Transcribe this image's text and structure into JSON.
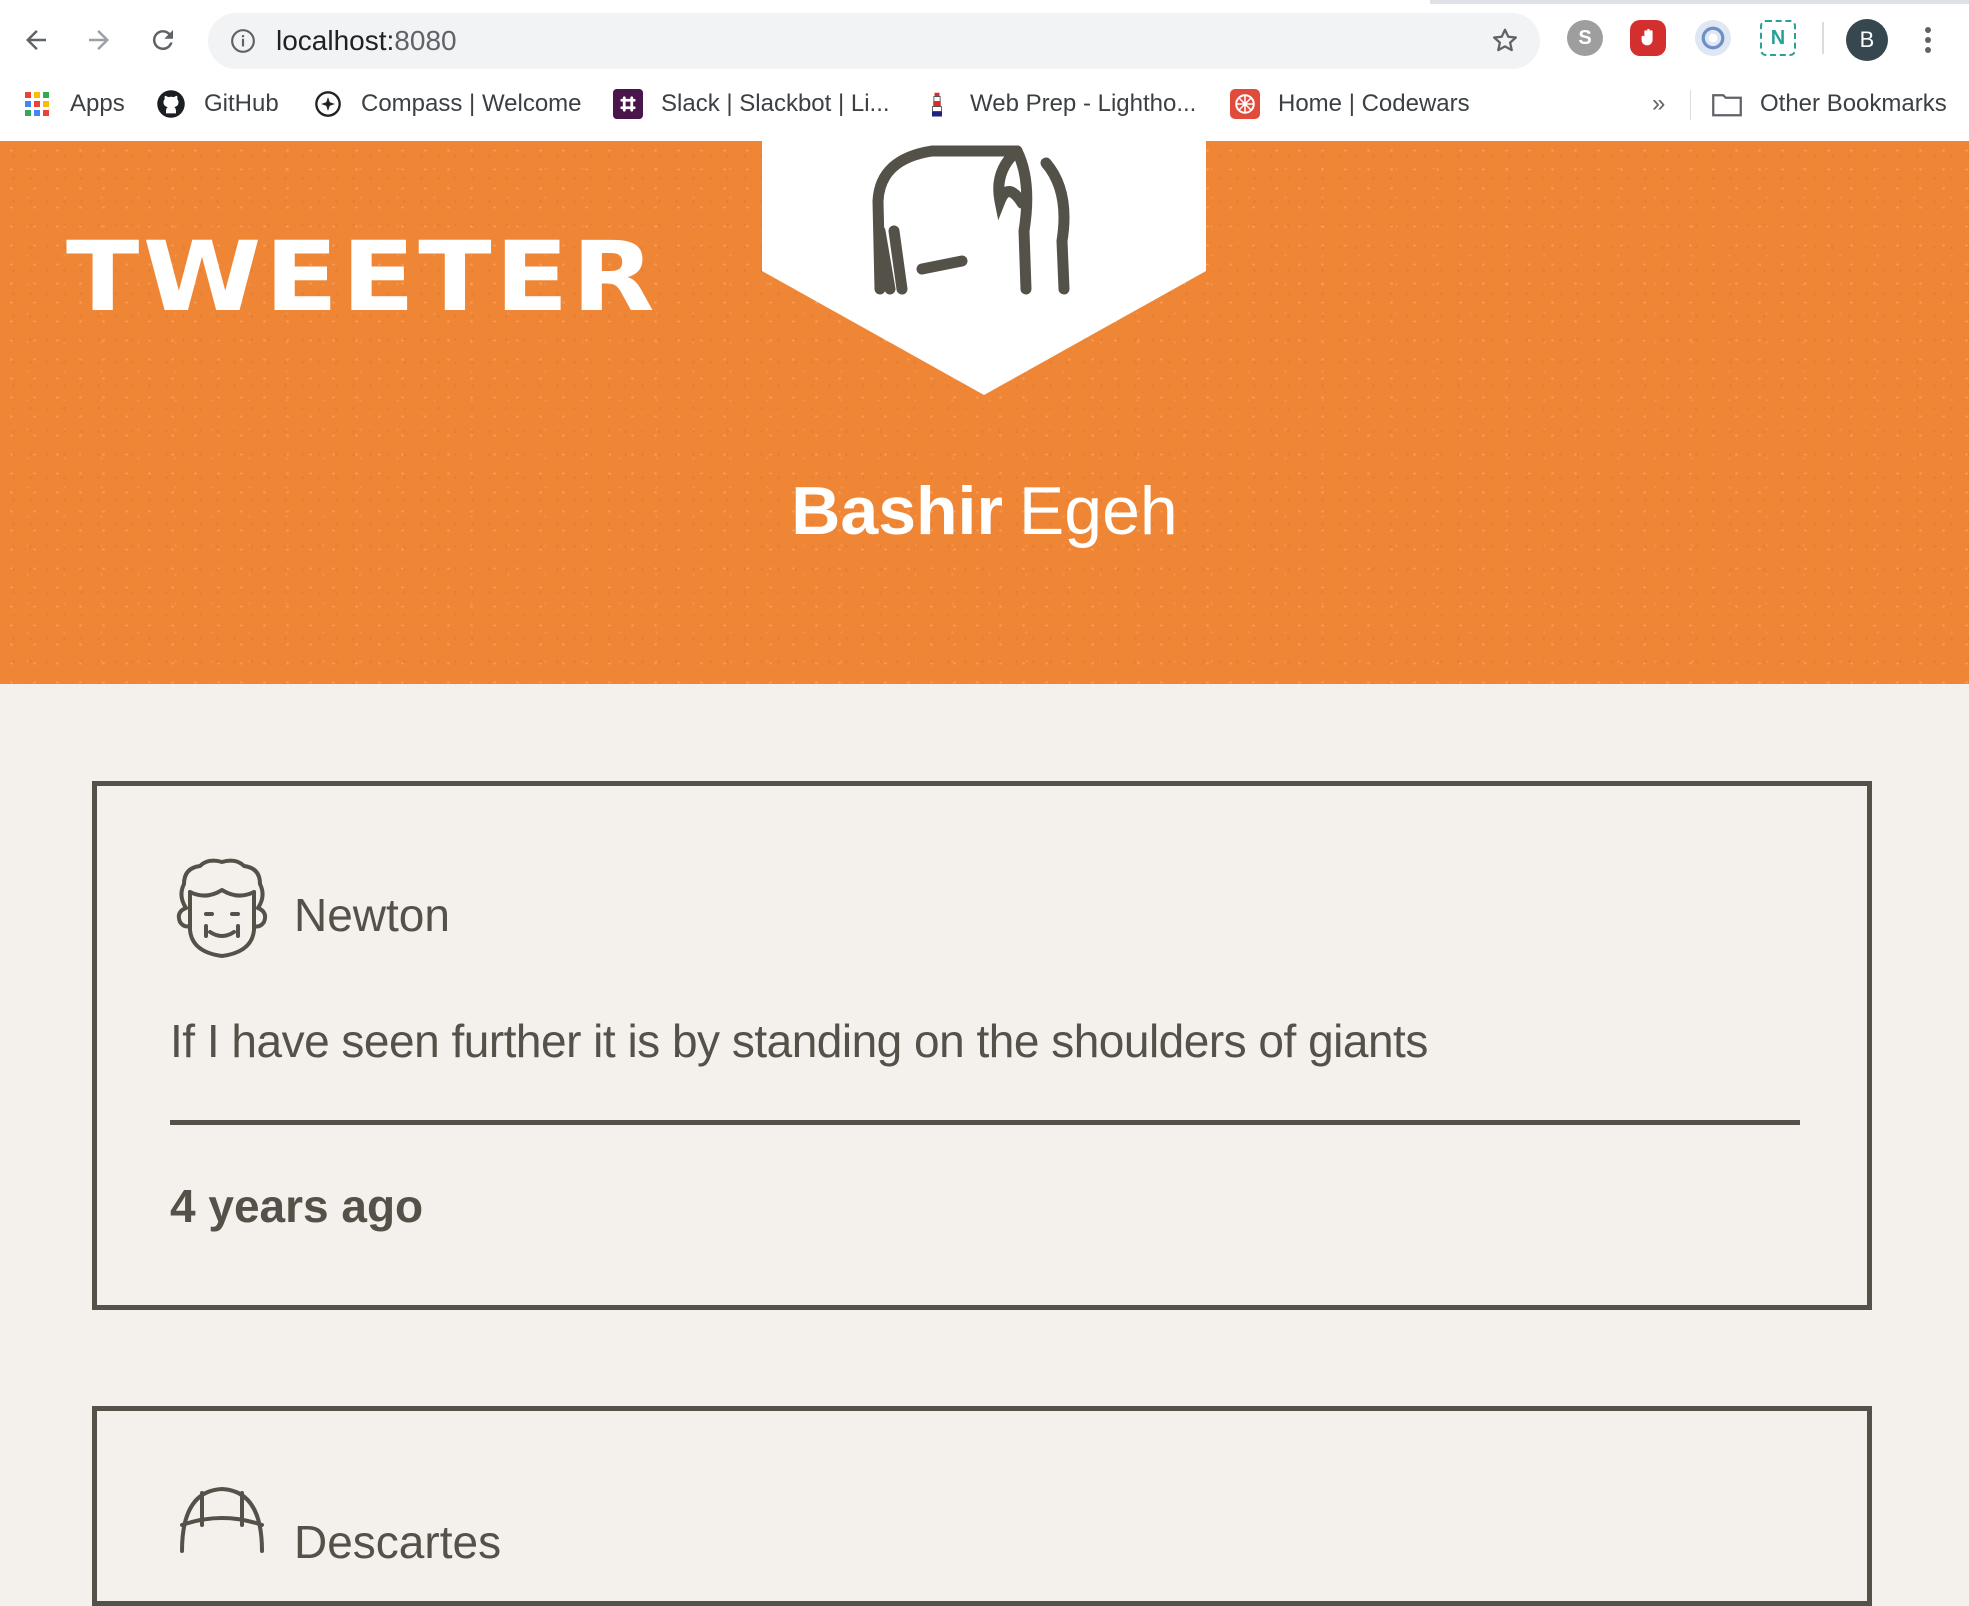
{
  "browser": {
    "url_host": "localhost:",
    "url_port": "8080",
    "profile_initial": "B",
    "bookmarks": [
      {
        "label": "Apps",
        "icon": "apps-grid-icon"
      },
      {
        "label": "GitHub",
        "icon": "github-icon"
      },
      {
        "label": "Compass | Welcome",
        "icon": "compass-icon"
      },
      {
        "label": "Slack | Slackbot | Li...",
        "icon": "slack-icon"
      },
      {
        "label": "Web Prep - Lightho...",
        "icon": "lighthouse-icon"
      },
      {
        "label": "Home | Codewars",
        "icon": "codewars-icon"
      }
    ],
    "overflow": "»",
    "other_bookmarks": "Other Bookmarks",
    "extensions": [
      "skype-icon",
      "adblock-icon",
      "extension-blue-icon",
      "extension-n-icon"
    ]
  },
  "header": {
    "logo": "TWEETER",
    "user": {
      "first": "Bashir",
      "last": "Egeh"
    },
    "accent_color": "#ef8636"
  },
  "tweets": [
    {
      "author": "Newton",
      "text": "If I have seen further it is by standing on the shoulders of giants",
      "time": "4 years ago"
    },
    {
      "author": "Descartes",
      "text": "",
      "time": ""
    }
  ]
}
